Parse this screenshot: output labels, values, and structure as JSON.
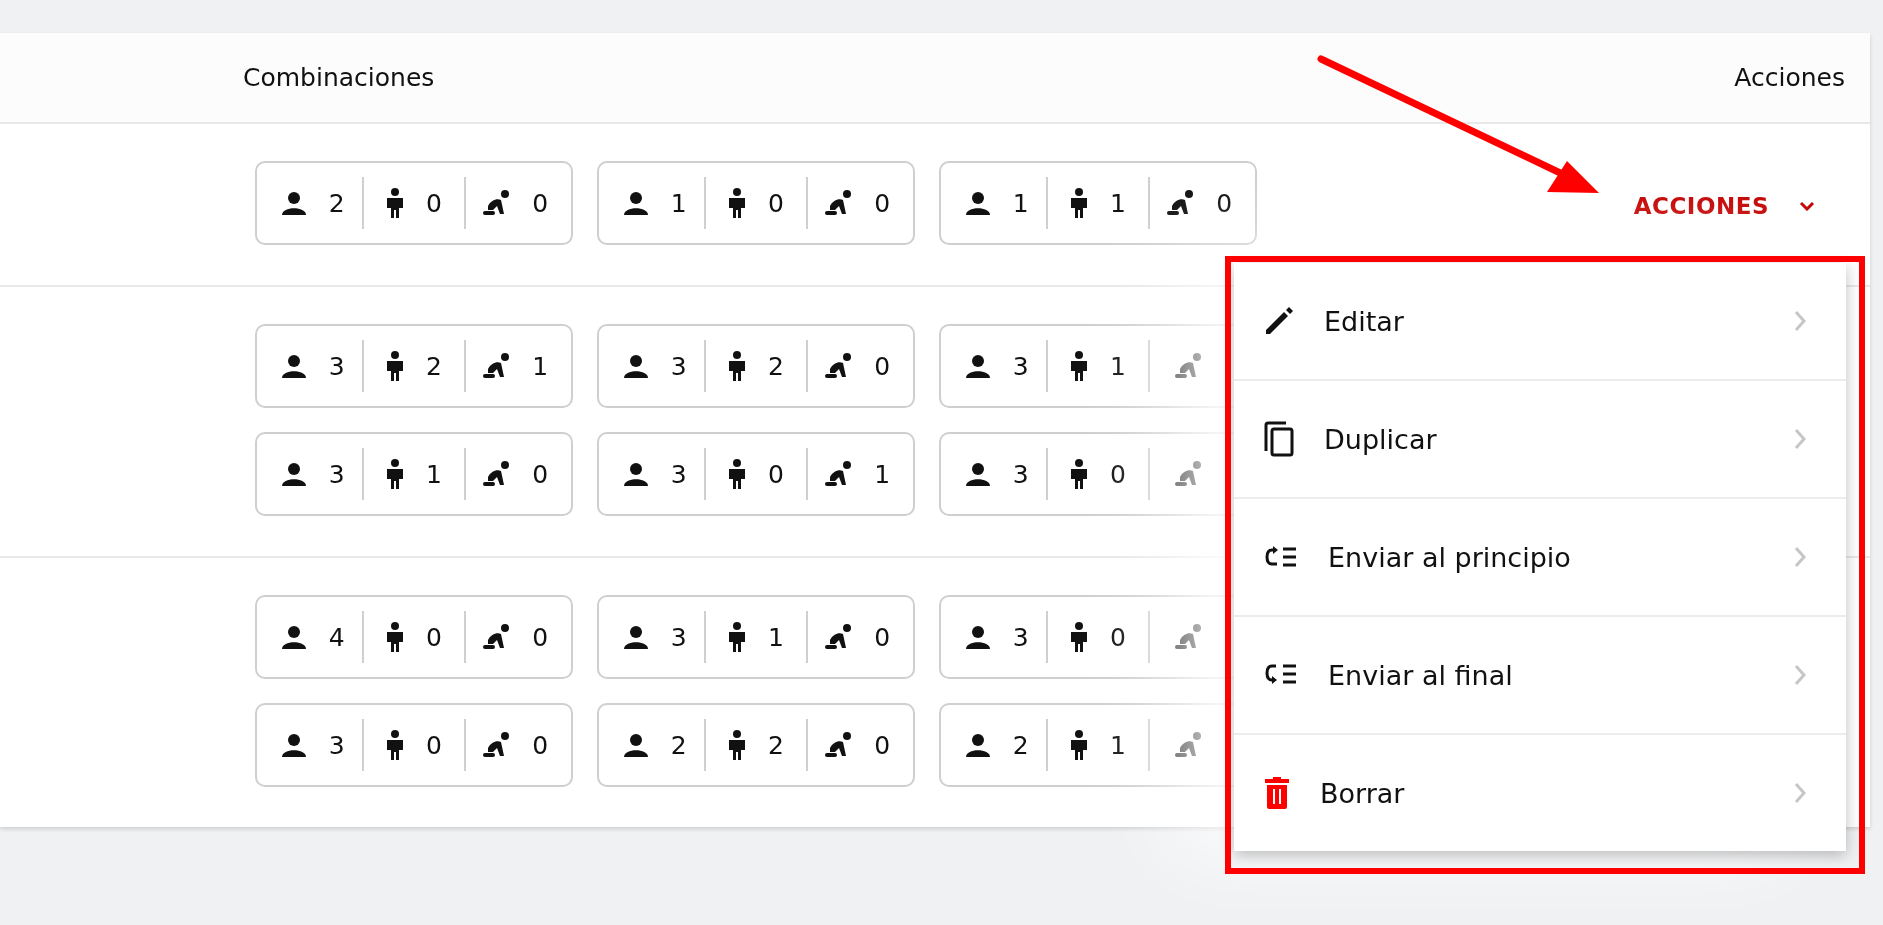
{
  "table": {
    "columns": [
      {
        "label": "Combinaciones"
      },
      {
        "label": "Acciones"
      }
    ],
    "rows": [
      {
        "combinations": [
          {
            "adults": "2",
            "children": "0",
            "babies": "0"
          },
          {
            "adults": "1",
            "children": "0",
            "babies": "0"
          },
          {
            "adults": "1",
            "children": "1",
            "babies": "0"
          }
        ],
        "action_button": "ACCIONES"
      },
      {
        "combinations": [
          {
            "adults": "3",
            "children": "2",
            "babies": "1"
          },
          {
            "adults": "3",
            "children": "2",
            "babies": "0"
          },
          {
            "adults": "3",
            "children": "1"
          },
          {
            "adults": "3",
            "children": "1",
            "babies": "0"
          },
          {
            "adults": "3",
            "children": "0",
            "babies": "1"
          },
          {
            "adults": "3",
            "children": "0"
          }
        ]
      },
      {
        "combinations": [
          {
            "adults": "4",
            "children": "0",
            "babies": "0"
          },
          {
            "adults": "3",
            "children": "1",
            "babies": "0"
          },
          {
            "adults": "3",
            "children": "0"
          },
          {
            "adults": "3",
            "children": "0",
            "babies": "0"
          },
          {
            "adults": "2",
            "children": "2",
            "babies": "0"
          },
          {
            "adults": "2",
            "children": "1"
          }
        ]
      }
    ]
  },
  "actions_menu": {
    "items": [
      {
        "label": "Editar",
        "kind": "edit"
      },
      {
        "label": "Duplicar",
        "kind": "duplicate"
      },
      {
        "label": "Enviar al principio",
        "kind": "send_first"
      },
      {
        "label": "Enviar al final",
        "kind": "send_last"
      },
      {
        "label": "Borrar",
        "kind": "delete"
      }
    ]
  }
}
